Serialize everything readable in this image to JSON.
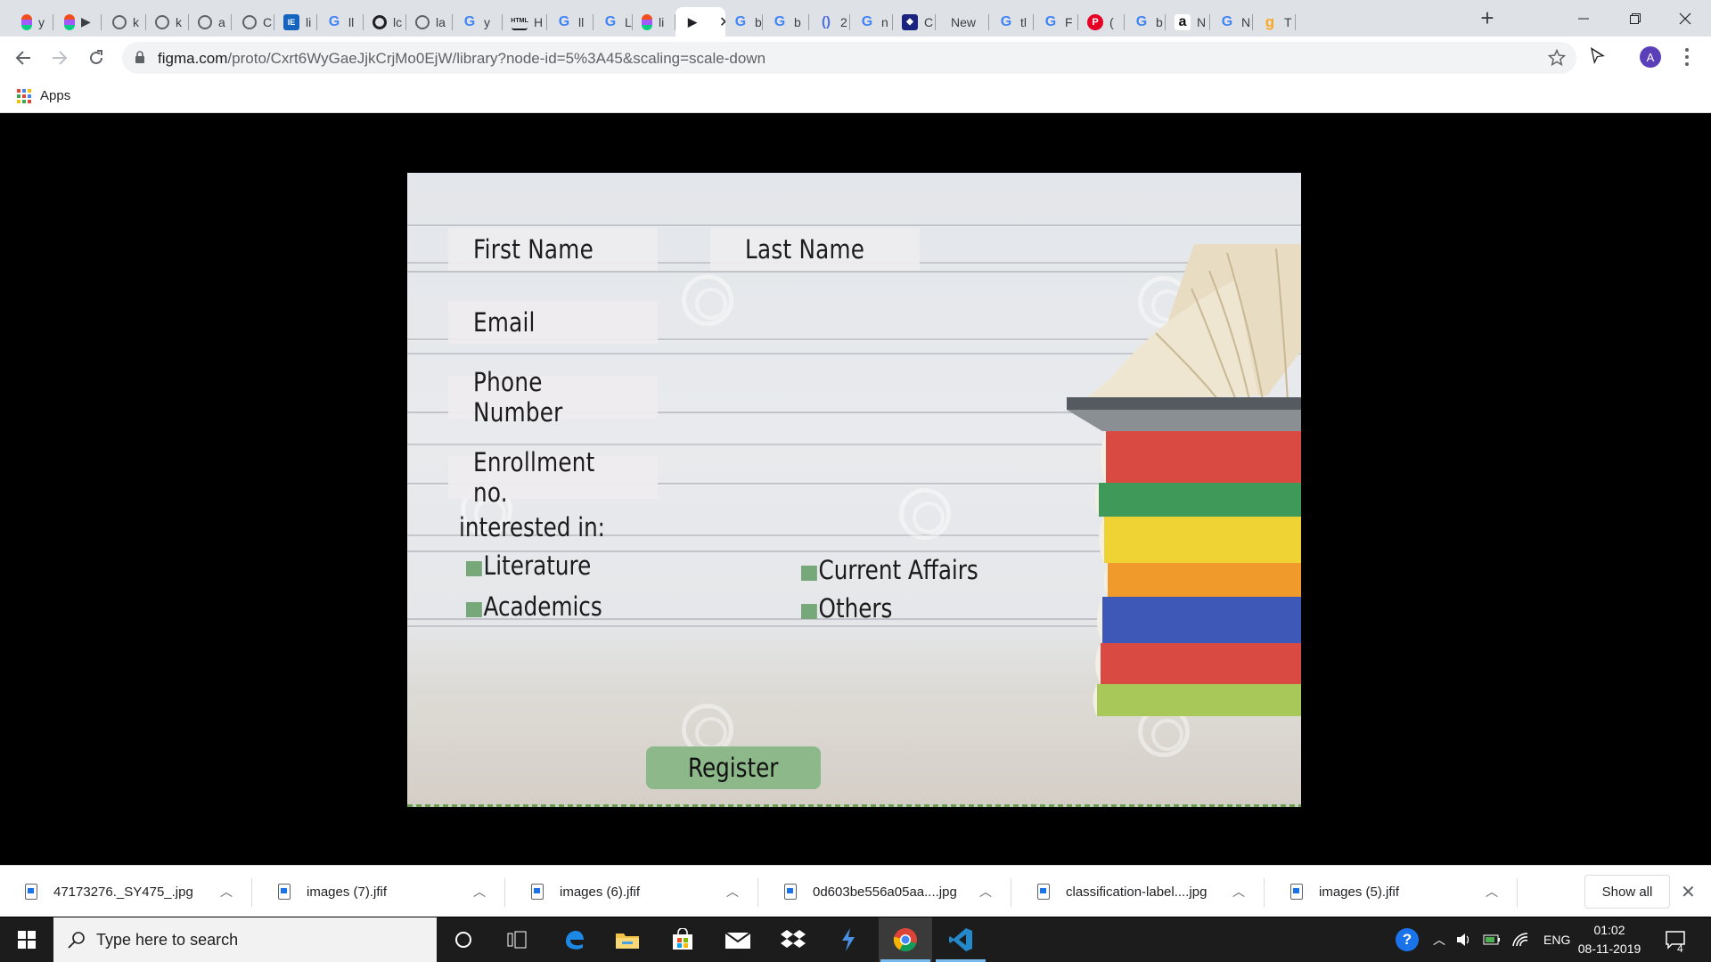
{
  "browser": {
    "tabs": [
      {
        "title": "y",
        "icon": "figma-icon",
        "color": "#f24e1e"
      },
      {
        "title": "▶",
        "icon": "figma-icon",
        "color": "#a259ff"
      },
      {
        "title": "k",
        "icon": "globe-icon",
        "color": "#5f6368"
      },
      {
        "title": "k",
        "icon": "globe-icon",
        "color": "#5f6368"
      },
      {
        "title": "a",
        "icon": "globe-icon",
        "color": "#5f6368"
      },
      {
        "title": "C",
        "icon": "globe-icon",
        "color": "#5f6368"
      },
      {
        "title": "li",
        "icon": "ie-icon",
        "color": "#1565c0"
      },
      {
        "title": "ll",
        "icon": "google-icon",
        "color": "#4285f4"
      },
      {
        "title": "lc",
        "icon": "github-icon",
        "color": "#202124"
      },
      {
        "title": "la",
        "icon": "globe-icon",
        "color": "#5f6368"
      },
      {
        "title": "y",
        "icon": "google-icon",
        "color": "#4285f4"
      },
      {
        "title": "H",
        "icon": "html-icon",
        "color": "#202124"
      },
      {
        "title": "ll",
        "icon": "google-icon",
        "color": "#4285f4"
      },
      {
        "title": "L",
        "icon": "google-icon",
        "color": "#4285f4"
      },
      {
        "title": "li",
        "icon": "figma-icon",
        "color": "#f24e1e"
      },
      {
        "title": "",
        "icon": "play-icon",
        "color": "#202124",
        "active": true
      },
      {
        "title": "b",
        "icon": "google-icon",
        "color": "#4285f4"
      },
      {
        "title": "b",
        "icon": "google-icon",
        "color": "#4285f4"
      },
      {
        "title": "2",
        "icon": "bracket-icon",
        "color": "#4a6ee0"
      },
      {
        "title": "n",
        "icon": "google-icon",
        "color": "#4285f4"
      },
      {
        "title": "C",
        "icon": "app-icon",
        "color": "#1a237e"
      },
      {
        "title": "New",
        "icon": "",
        "color": "#202124"
      },
      {
        "title": "tl",
        "icon": "google-icon",
        "color": "#4285f4"
      },
      {
        "title": "F",
        "icon": "google-icon",
        "color": "#4285f4"
      },
      {
        "title": "(",
        "icon": "pinterest-icon",
        "color": "#e60023"
      },
      {
        "title": "b",
        "icon": "google-icon",
        "color": "#4285f4"
      },
      {
        "title": "N",
        "icon": "amazon-icon",
        "color": "#232f3e"
      },
      {
        "title": "N",
        "icon": "google-icon",
        "color": "#4285f4"
      },
      {
        "title": "T",
        "icon": "g-icon",
        "color": "#f9a825"
      }
    ],
    "url_host": "figma.com",
    "url_path": "/proto/Cxrt6WyGaeJjkCrjMo0EjW/library?node-id=5%3A45&scaling=scale-down",
    "avatar_letter": "A",
    "bookmarks_apps_label": "Apps"
  },
  "form": {
    "first_name": "First Name",
    "last_name": "Last Name",
    "email": "Email",
    "phone": "Phone Number",
    "enrollment": "Enrollment no.",
    "interested_heading": "interested in:",
    "options": {
      "literature": "Literature",
      "academics": "Academics",
      "current_affairs": "Current Affairs",
      "others": "Others"
    },
    "register_label": "Register",
    "accent_color": "#8db889",
    "checkbox_color": "#76a87a"
  },
  "downloads": {
    "items": [
      "47173276._SY475_.jpg",
      "images (7).jfif",
      "images (6).jfif",
      "0d603be556a05aa....jpg",
      "classification-label....jpg",
      "images (5).jfif"
    ],
    "show_all_label": "Show all"
  },
  "taskbar": {
    "search_placeholder": "Type here to search",
    "language": "ENG",
    "time": "01:02",
    "date": "08-11-2019",
    "notification_count": "4"
  }
}
